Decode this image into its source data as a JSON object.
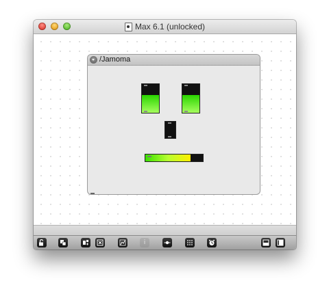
{
  "window": {
    "title": "Max 6.1 (unlocked)",
    "traffic_lights": {
      "close": "#e0443a",
      "minimize": "#e8a525",
      "maximize": "#5ebf34"
    }
  },
  "patch": {
    "bpatcher": {
      "title": "/Jamoma",
      "meters": [
        {
          "name": "left-eye-meter",
          "orientation": "vertical",
          "level": 0.62
        },
        {
          "name": "right-eye-meter",
          "orientation": "vertical",
          "level": 0.62
        },
        {
          "name": "nose-meter",
          "orientation": "vertical",
          "level": 0.0
        },
        {
          "name": "mouth-meter",
          "orientation": "horizontal",
          "level": 0.78
        }
      ],
      "meter_colors": {
        "low": "#2ad500",
        "high": "#a6ff5e",
        "background": "#111111"
      }
    }
  },
  "toolbar": {
    "buttons": [
      {
        "icon": "lock-icon",
        "glyph": "🔓",
        "enabled": true
      },
      {
        "icon": "presentation-icon",
        "glyph": "◧",
        "enabled": true
      },
      {
        "icon": "new-object-icon",
        "glyph": "⊞",
        "enabled": true
      },
      {
        "icon": "delete-icon",
        "glyph": "✕",
        "enabled": true
      },
      {
        "icon": "graph-icon",
        "glyph": "⌇",
        "enabled": true
      },
      {
        "icon": "info-icon",
        "glyph": "i",
        "enabled": false
      },
      {
        "icon": "connect-icon",
        "glyph": "⦿",
        "enabled": true
      },
      {
        "icon": "grid-icon",
        "glyph": "⋮⋮",
        "enabled": true
      },
      {
        "icon": "clock-icon",
        "glyph": "◔",
        "enabled": true
      },
      {
        "icon": "split-horizontal-icon",
        "glyph": "⬓",
        "enabled": true
      },
      {
        "icon": "split-vertical-icon",
        "glyph": "◨",
        "enabled": true
      }
    ]
  }
}
